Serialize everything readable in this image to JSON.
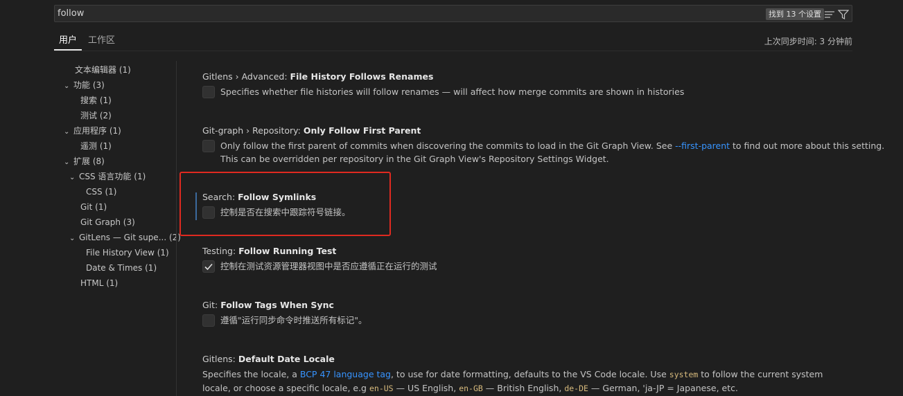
{
  "search": {
    "value": "follow",
    "result_badge": "找到 13 个设置"
  },
  "tabs": {
    "user": "用户",
    "workspace": "工作区"
  },
  "sync_status": "上次同步时间: 3 分钟前",
  "toc": [
    {
      "label": "文本编辑器",
      "count": "(1)",
      "chev": ""
    },
    {
      "label": "功能",
      "count": "(3)",
      "chev": "﹀"
    },
    {
      "label": "搜索",
      "count": "(1)",
      "chev": ""
    },
    {
      "label": "测试",
      "count": "(2)",
      "chev": ""
    },
    {
      "label": "应用程序",
      "count": "(1)",
      "chev": "﹀"
    },
    {
      "label": "遥测",
      "count": "(1)",
      "chev": ""
    },
    {
      "label": "扩展",
      "count": "(8)",
      "chev": "﹀"
    },
    {
      "label": "CSS 语言功能",
      "count": "(1)",
      "chev": "﹀"
    },
    {
      "label": "CSS",
      "count": "(1)",
      "chev": ""
    },
    {
      "label": "Git",
      "count": "(1)",
      "chev": ""
    },
    {
      "label": "Git Graph",
      "count": "(3)",
      "chev": ""
    },
    {
      "label": "GitLens — Git supe...",
      "count": "(2)",
      "chev": "﹀"
    },
    {
      "label": "File History View",
      "count": "(1)",
      "chev": ""
    },
    {
      "label": "Date & Times",
      "count": "(1)",
      "chev": ""
    },
    {
      "label": "HTML",
      "count": "(1)",
      "chev": ""
    }
  ],
  "settings": [
    {
      "category": "Gitlens › Advanced: ",
      "name": "File History Follows Renames",
      "checked": false,
      "description": "Specifies whether file histories will follow renames — will affect how merge commits are shown in histories"
    },
    {
      "category": "Git-graph › Repository: ",
      "name": "Only Follow First Parent",
      "checked": false,
      "desc_before_link": "Only follow the first parent of commits when discovering the commits to load in the Git Graph View. See ",
      "desc_link": "--first-parent",
      "desc_after_link": " to find out more about this setting.",
      "desc_line2": "This can be overridden per repository in the Git Graph View's Repository Settings Widget."
    },
    {
      "category": "Search: ",
      "name": "Follow Symlinks",
      "checked": false,
      "description": "控制是否在搜索中跟踪符号链接。"
    },
    {
      "category": "Testing: ",
      "name": "Follow Running Test",
      "checked": true,
      "description": "控制在测试资源管理器视图中是否应遵循正在运行的测试"
    },
    {
      "category": "Git: ",
      "name": "Follow Tags When Sync",
      "checked": false,
      "description": "遵循\"运行同步命令时推送所有标记\"。"
    },
    {
      "category": "Gitlens: ",
      "name": "Default Date Locale",
      "d1": "Specifies the locale, a ",
      "link": "BCP 47 language tag",
      "d2": ", to use for date formatting, defaults to the VS Code locale. Use ",
      "code1": "system",
      "d3": " to follow the current system locale, or choose a specific locale, e.g ",
      "code2": "en-US",
      "d4": " — US English, ",
      "code3": "en-GB",
      "d5": " — British English, ",
      "code4": "de-DE",
      "d6": " — German, 'ja-JP = Japanese, etc."
    }
  ]
}
